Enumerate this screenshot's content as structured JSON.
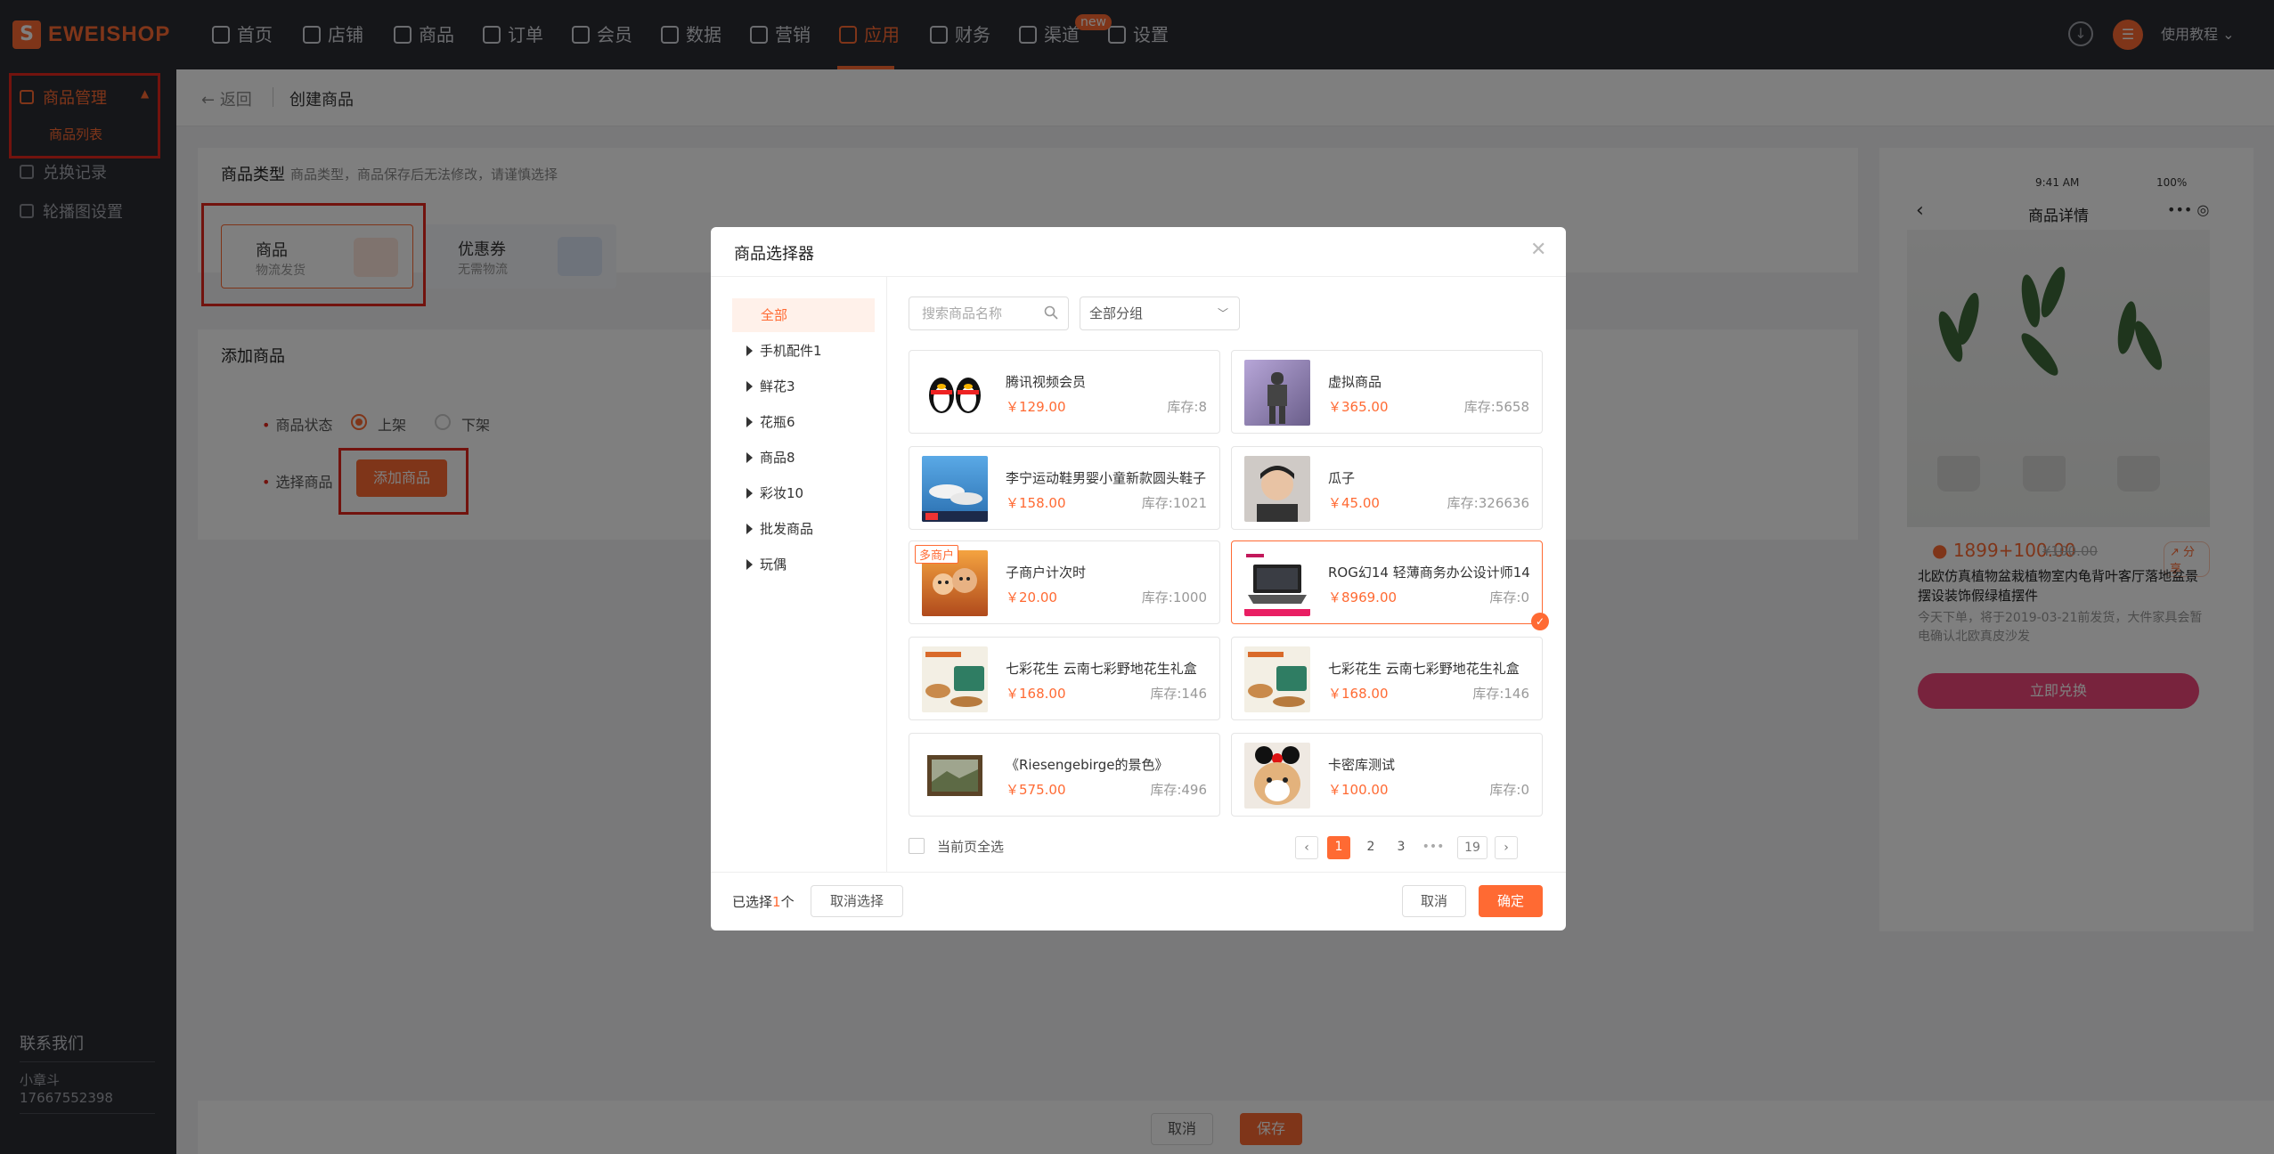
{
  "brand": {
    "logo_text": "EWEISHOP"
  },
  "topnav": {
    "items": [
      {
        "label": "首页",
        "icon": "home-icon"
      },
      {
        "label": "店铺",
        "icon": "store-icon"
      },
      {
        "label": "商品",
        "icon": "goods-icon"
      },
      {
        "label": "订单",
        "icon": "order-icon"
      },
      {
        "label": "会员",
        "icon": "member-icon"
      },
      {
        "label": "数据",
        "icon": "data-icon"
      },
      {
        "label": "营销",
        "icon": "marketing-icon"
      },
      {
        "label": "应用",
        "icon": "app-icon",
        "active": true
      },
      {
        "label": "财务",
        "icon": "finance-icon"
      },
      {
        "label": "渠道",
        "icon": "channel-icon"
      },
      {
        "label": "设置",
        "icon": "settings-icon"
      }
    ],
    "new_badge": "new",
    "user_menu": "使用教程"
  },
  "sidebar": {
    "group_label": "商品管理",
    "sub_item": "商品列表",
    "items": [
      {
        "label": "兑换记录",
        "icon": "exchange-icon"
      },
      {
        "label": "轮播图设置",
        "icon": "carousel-icon"
      }
    ],
    "contact_title": "联系我们",
    "contact_name": "小章斗",
    "contact_phone": "17667552398"
  },
  "header": {
    "back_label": "返回",
    "title": "创建商品"
  },
  "goods_type": {
    "title": "商品类型",
    "hint": "商品类型，商品保存后无法修改，请谨慎选择",
    "options": [
      {
        "title": "商品",
        "sub": "物流发货",
        "selected": true
      },
      {
        "title": "优惠券",
        "sub": "无需物流",
        "selected": false
      }
    ]
  },
  "add_goods": {
    "title": "添加商品",
    "status_label": "商品状态",
    "on_label": "上架",
    "off_label": "下架",
    "select_label": "选择商品",
    "add_button": "添加商品"
  },
  "footer": {
    "cancel": "取消",
    "save": "保存"
  },
  "phone": {
    "time": "9:41 AM",
    "battery": "100%",
    "nav_title": "商品详情",
    "price": "1899+100.00",
    "old_price": "¥100.00",
    "share": "分享",
    "title": "北欧仿真植物盆栽植物室内龟背叶客厅落地盆景摆设装饰假绿植摆件",
    "desc": "今天下单，将于2019-03-21前发货，大件家具会暂电确认北欧真皮沙发",
    "button": "立即兑换"
  },
  "modal": {
    "title": "商品选择器",
    "tree_all": "全部",
    "tree": [
      "手机配件1",
      "鲜花3",
      "花瓶6",
      "商品8",
      "彩妆10",
      "批发商品",
      "玩偶"
    ],
    "search_placeholder": "搜索商品名称",
    "group_select": "全部分组",
    "goods": [
      {
        "name": "腾讯视频会员",
        "price": "￥129.00",
        "stock": "库存:8",
        "thumb": "penguins",
        "selected": false
      },
      {
        "name": "虚拟商品",
        "price": "￥365.00",
        "stock": "库存:5658",
        "thumb": "figure",
        "selected": false
      },
      {
        "name": "李宁运动鞋男婴小童新款圆头鞋子",
        "price": "￥158.00",
        "stock": "库存:1021",
        "thumb": "shoes",
        "selected": false
      },
      {
        "name": "瓜子",
        "price": "￥45.00",
        "stock": "库存:326636",
        "thumb": "person",
        "selected": false
      },
      {
        "name": "子商户计次时",
        "price": "￥20.00",
        "stock": "库存:1000",
        "thumb": "cartoon",
        "tag": "多商户",
        "selected": false
      },
      {
        "name": "ROG幻14 轻薄商务办公设计师14",
        "price": "￥8969.00",
        "stock": "库存:0",
        "thumb": "laptop",
        "selected": true
      },
      {
        "name": "七彩花生 云南七彩野地花生礼盒",
        "price": "￥168.00",
        "stock": "库存:146",
        "thumb": "peanut",
        "selected": false
      },
      {
        "name": "七彩花生 云南七彩野地花生礼盒",
        "price": "￥168.00",
        "stock": "库存:146",
        "thumb": "peanut",
        "selected": false
      },
      {
        "name": "《Riesengebirge的景色》",
        "price": "￥575.00",
        "stock": "库存:496",
        "thumb": "painting",
        "selected": false
      },
      {
        "name": "卡密库测试",
        "price": "￥100.00",
        "stock": "库存:0",
        "thumb": "dog",
        "selected": false
      }
    ],
    "select_all_label": "当前页全选",
    "pagination": {
      "pages": [
        "1",
        "2",
        "3"
      ],
      "ellipsis": "•••",
      "last": "19",
      "current": "1"
    },
    "selected_prefix": "已选择",
    "selected_count": "1",
    "selected_suffix": "个",
    "clear_button": "取消选择",
    "cancel_button": "取消",
    "confirm_button": "确定"
  },
  "colors": {
    "accent": "#ff6a33",
    "nav_bg": "#2b2d33",
    "highlight_frame": "#e5261c",
    "phone_button": "#f0467a"
  }
}
